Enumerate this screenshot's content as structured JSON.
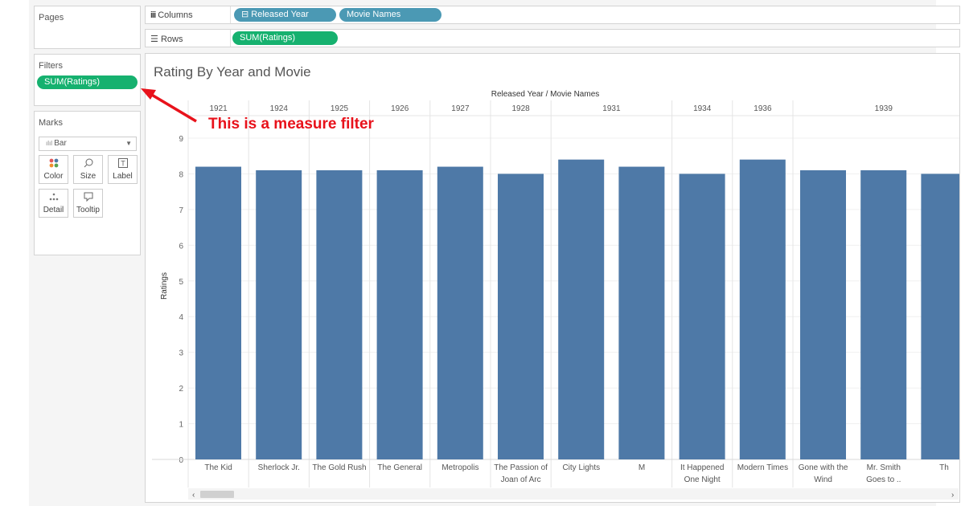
{
  "panels": {
    "pages_title": "Pages",
    "filters_title": "Filters",
    "filter_pill": "SUM(Ratings)",
    "marks_title": "Marks",
    "mark_type": "Bar",
    "mark_buttons": [
      {
        "label": "Color",
        "icon": "color-icon"
      },
      {
        "label": "Size",
        "icon": "size-icon"
      },
      {
        "label": "Label",
        "icon": "label-icon"
      },
      {
        "label": "Detail",
        "icon": "detail-icon"
      },
      {
        "label": "Tooltip",
        "icon": "tooltip-icon"
      }
    ]
  },
  "shelves": {
    "columns_label": "Columns",
    "columns_pills": [
      "⊟ Released Year",
      "Movie Names"
    ],
    "rows_label": "Rows",
    "rows_pills": [
      "SUM(Ratings)"
    ]
  },
  "annotation": "This is a measure filter",
  "colors": {
    "bar": "#4e79a7",
    "measure_pill": "#16b16f",
    "dimension_pill": "#4b99b4",
    "annotation": "#e8121b"
  },
  "chart_data": {
    "type": "bar",
    "title": "Rating By Year and Movie",
    "header": "Released Year  /  Movie Names",
    "ylabel": "Ratings",
    "ylim": [
      0,
      9
    ],
    "yticks": [
      0,
      1,
      2,
      3,
      4,
      5,
      6,
      7,
      8,
      9
    ],
    "categories": [
      "The Kid",
      "Sherlock Jr.",
      "The Gold Rush",
      "The General",
      "Metropolis",
      "The Passion of Joan of Arc",
      "City Lights",
      "M",
      "It Happened One Night",
      "Modern Times",
      "Gone with the Wind",
      "Mr. Smith Goes to ..",
      "Th"
    ],
    "category_lines": [
      [
        "The Kid"
      ],
      [
        "Sherlock Jr."
      ],
      [
        "The Gold Rush"
      ],
      [
        "The General"
      ],
      [
        "Metropolis"
      ],
      [
        "The Passion of",
        "Joan of Arc"
      ],
      [
        "City Lights"
      ],
      [
        "M"
      ],
      [
        "It Happened",
        "One Night"
      ],
      [
        "Modern Times"
      ],
      [
        "Gone with the",
        "Wind"
      ],
      [
        "Mr. Smith",
        "Goes to .."
      ],
      [
        "Th"
      ]
    ],
    "years": [
      "1921",
      "1924",
      "1925",
      "1926",
      "1927",
      "1928",
      "1931",
      "1934",
      "1936",
      "1939"
    ],
    "year_spans": [
      1,
      1,
      1,
      1,
      1,
      1,
      2,
      1,
      1,
      3
    ],
    "values": [
      8.2,
      8.1,
      8.1,
      8.1,
      8.2,
      8.0,
      8.4,
      8.2,
      8.0,
      8.4,
      8.1,
      8.1,
      8.0
    ]
  }
}
